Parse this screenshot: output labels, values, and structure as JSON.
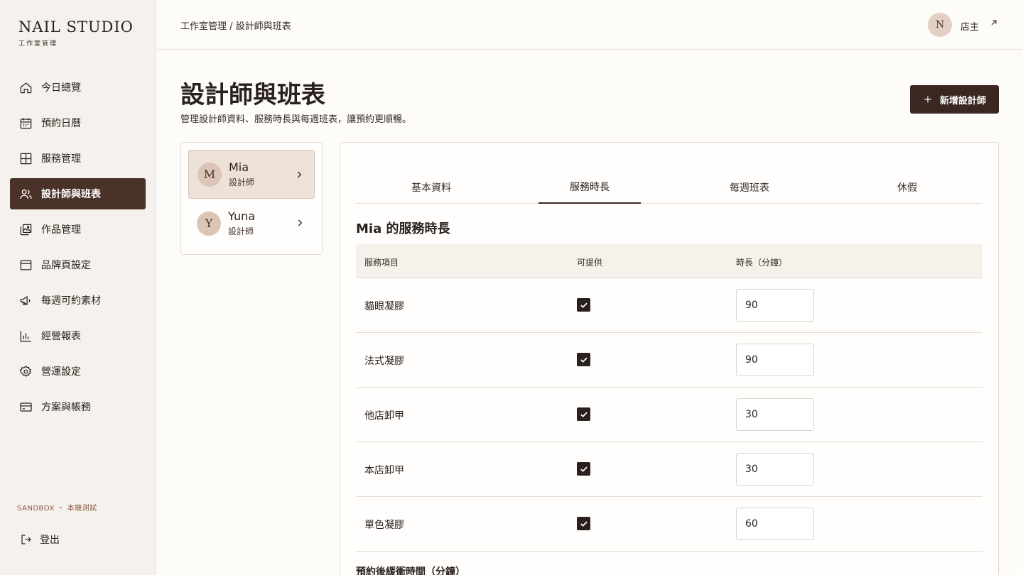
{
  "brand": {
    "name": "NAIL STUDIO",
    "subtitle": "工作室管理"
  },
  "sidebar": {
    "items": [
      {
        "label": "今日總覽",
        "icon": "home-icon"
      },
      {
        "label": "預約日曆",
        "icon": "calendar-icon"
      },
      {
        "label": "服務管理",
        "icon": "grid-icon"
      },
      {
        "label": "設計師與班表",
        "icon": "users-icon",
        "active": true
      },
      {
        "label": "作品管理",
        "icon": "gallery-icon"
      },
      {
        "label": "品牌頁設定",
        "icon": "layout-icon"
      },
      {
        "label": "每週可約素材",
        "icon": "megaphone-icon"
      },
      {
        "label": "經營報表",
        "icon": "bar-chart-icon"
      },
      {
        "label": "營運設定",
        "icon": "gear-icon"
      },
      {
        "label": "方案與帳務",
        "icon": "credit-card-icon"
      }
    ],
    "env_label": "SANDBOX ・ 本機測試",
    "logout_label": "登出"
  },
  "header": {
    "breadcrumb": "工作室管理 / 設計師與班表",
    "owner_initial": "N",
    "owner_label": "店主"
  },
  "page": {
    "title": "設計師與班表",
    "description": "管理設計師資料、服務時長與每週班表，讓預約更順暢。",
    "add_button": "新增設計師"
  },
  "designers": [
    {
      "initial": "M",
      "name": "Mia",
      "role": "設計師",
      "active": true
    },
    {
      "initial": "Y",
      "name": "Yuna",
      "role": "設計師"
    }
  ],
  "tabs": [
    "基本資料",
    "服務時長",
    "每週班表",
    "休假"
  ],
  "active_tab": 1,
  "section_title": "Mia 的服務時長",
  "table": {
    "headers": [
      "服務項目",
      "可提供",
      "時長（分鐘）"
    ],
    "rows": [
      {
        "service": "貓眼凝膠",
        "available": true,
        "duration": "90"
      },
      {
        "service": "法式凝膠",
        "available": true,
        "duration": "90"
      },
      {
        "service": "他店卸甲",
        "available": true,
        "duration": "30"
      },
      {
        "service": "本店卸甲",
        "available": true,
        "duration": "30"
      },
      {
        "service": "單色凝膠",
        "available": true,
        "duration": "60"
      }
    ]
  },
  "buffer_label": "預約後緩衝時間（分鐘）",
  "colors": {
    "accent": "#4a3228",
    "button": "#3b2722",
    "active_designer_bg": "#eee2d8"
  }
}
